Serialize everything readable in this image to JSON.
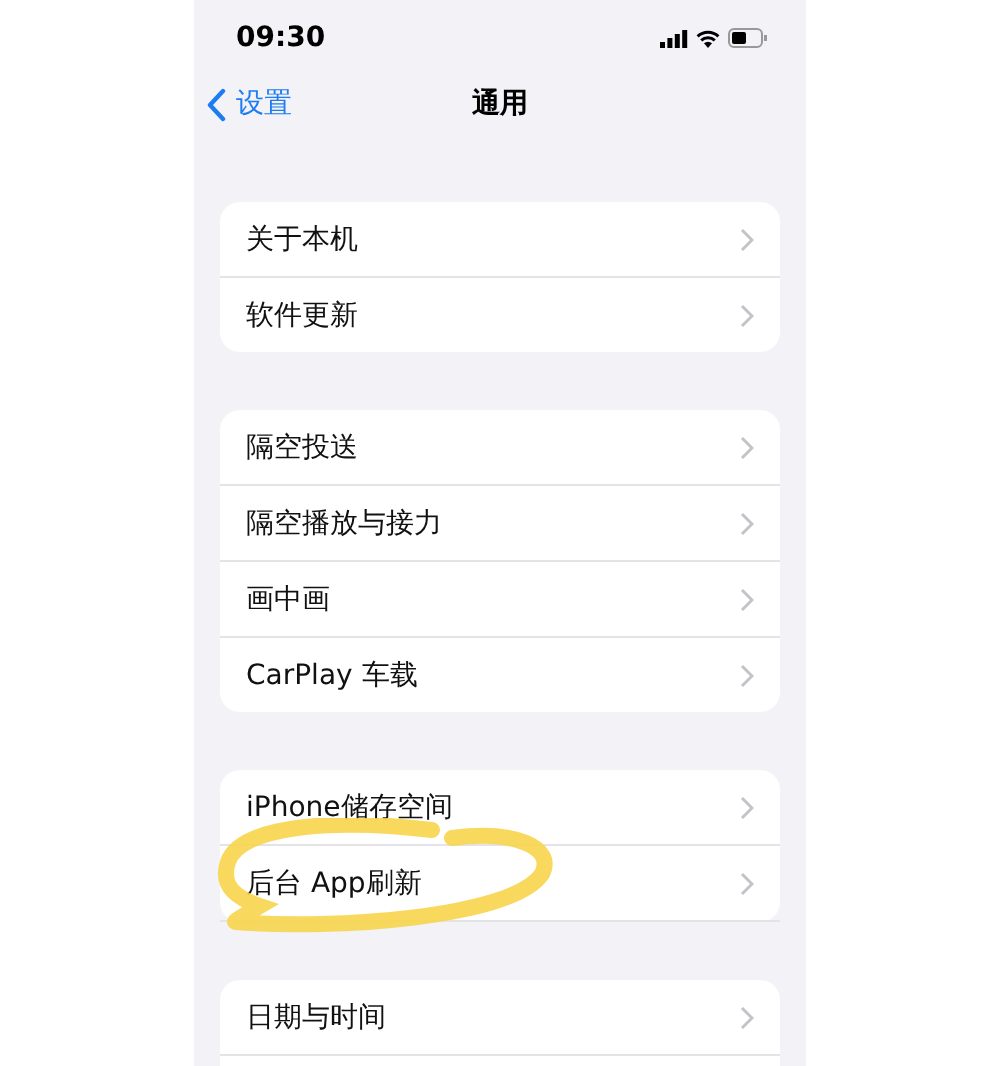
{
  "status_bar": {
    "time": "09:30"
  },
  "nav": {
    "back": "设置",
    "title": "通用"
  },
  "groups": [
    {
      "rows": [
        {
          "label": "关于本机",
          "highlighted": false
        },
        {
          "label": "软件更新",
          "highlighted": false
        }
      ]
    },
    {
      "rows": [
        {
          "label": "隔空投送",
          "highlighted": false
        },
        {
          "label": "隔空播放与接力",
          "highlighted": false
        },
        {
          "label": "画中画",
          "highlighted": false
        },
        {
          "label": "CarPlay 车载",
          "highlighted": false
        }
      ]
    },
    {
      "rows": [
        {
          "label": "iPhone储存空间",
          "highlighted": false
        },
        {
          "label": "后台 App刷新",
          "highlighted": true
        }
      ]
    },
    {
      "rows": [
        {
          "label": "日期与时间",
          "highlighted": false
        }
      ]
    }
  ]
}
